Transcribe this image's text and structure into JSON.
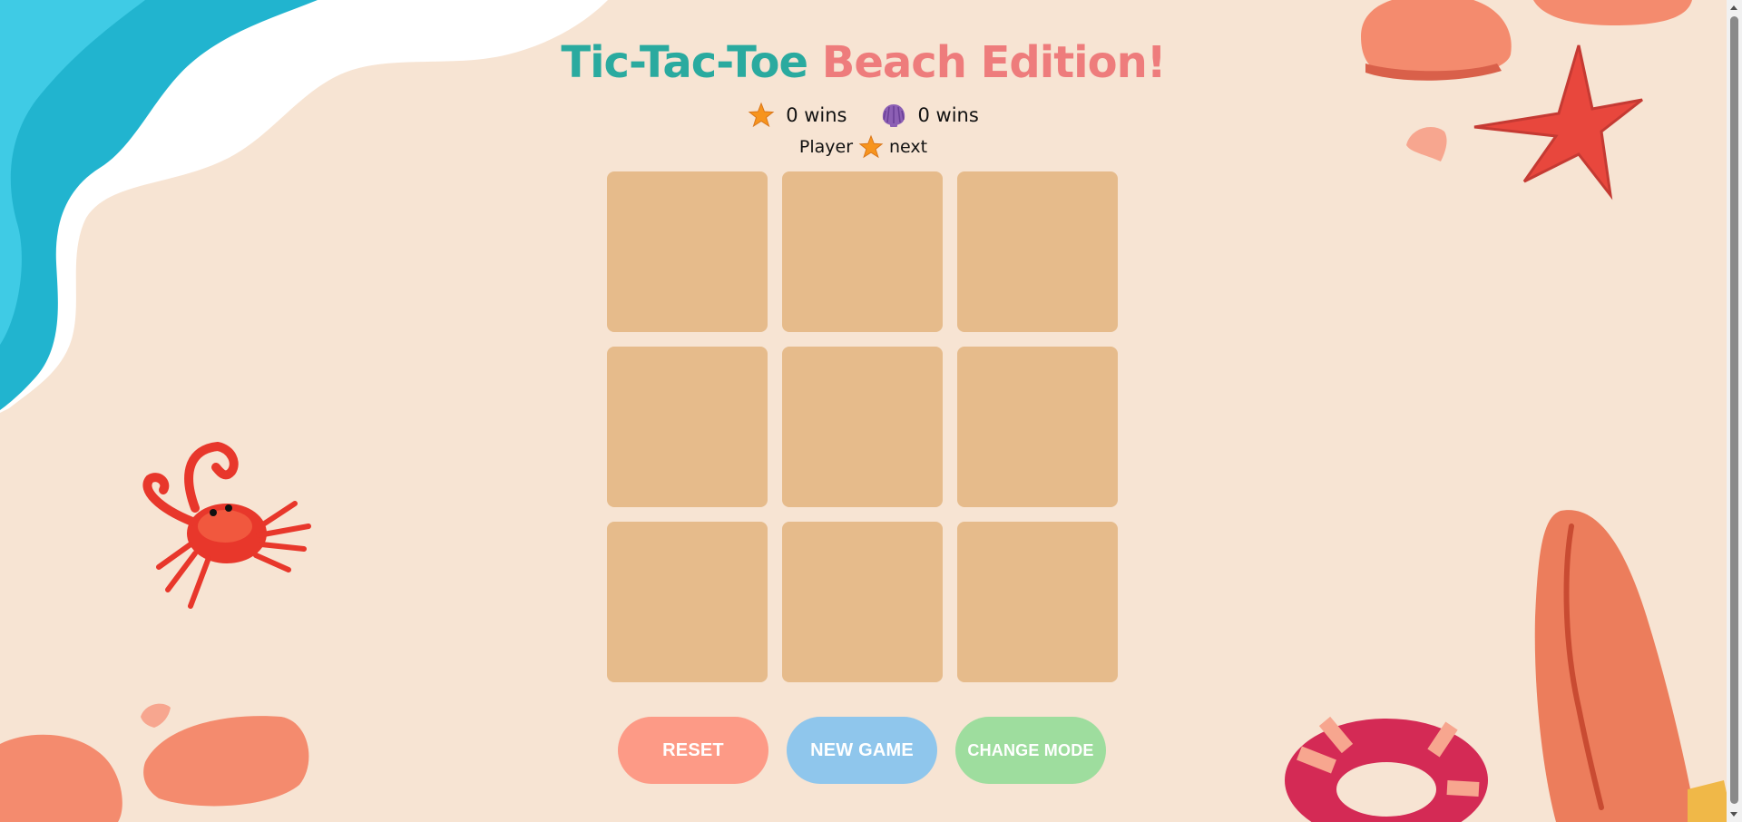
{
  "title": {
    "part1": "Tic-Tac-Toe",
    "part2": "Beach Edition!"
  },
  "scores": [
    {
      "player": "starfish",
      "icon": "starfish-icon",
      "text": "0 wins"
    },
    {
      "player": "shell",
      "icon": "shell-icon",
      "text": "0 wins"
    }
  ],
  "turn": {
    "prefix": "Player",
    "icon": "starfish-icon",
    "suffix": "next"
  },
  "board": {
    "cells": [
      "",
      "",
      "",
      "",
      "",
      "",
      "",
      "",
      ""
    ]
  },
  "buttons": {
    "reset": "RESET",
    "new_game": "NEW GAME",
    "change_mode": "CHANGE MODE"
  },
  "colors": {
    "background": "#f7e4d3",
    "title_primary": "#2aaa9f",
    "title_secondary": "#ee7c7c",
    "cell": "#e6bb8b",
    "reset": "#fd9a86",
    "new_game": "#8fc6ec",
    "change_mode": "#9edd9e"
  }
}
